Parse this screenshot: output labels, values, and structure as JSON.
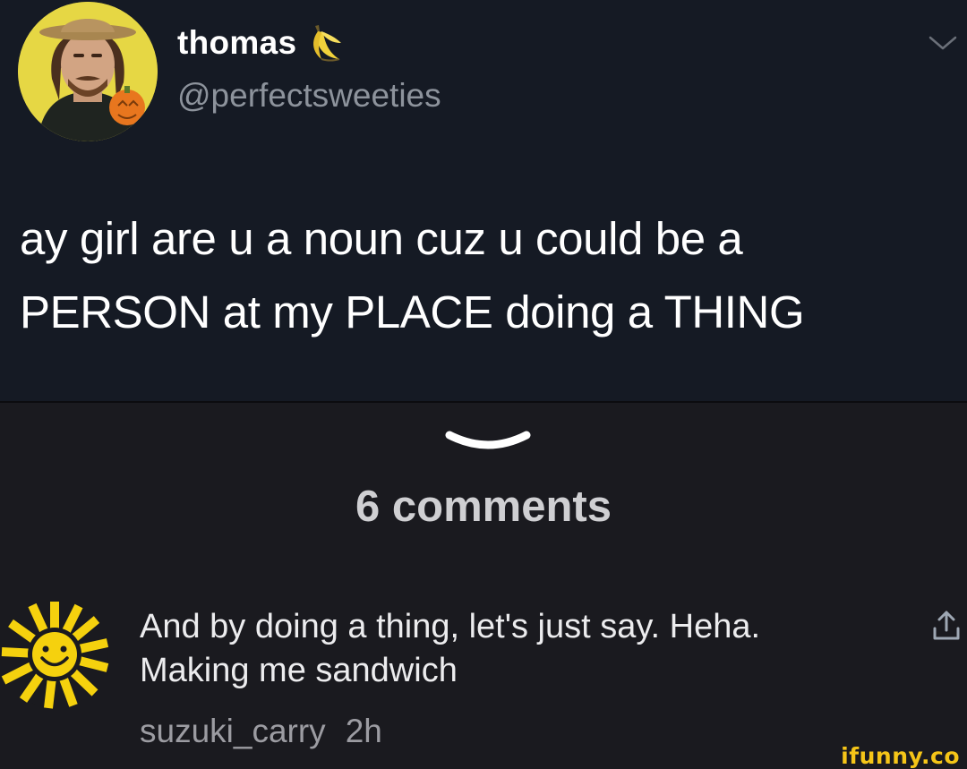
{
  "tweet": {
    "display_name": "thomas",
    "name_emoji": "banana-icon",
    "handle": "@perfectsweeties",
    "text_line1": "ay girl are u a noun cuz u could be a",
    "text_line2": "PERSON at my PLACE doing a THING"
  },
  "comments_header": {
    "count_label": "6 comments"
  },
  "comment": {
    "text_line1": "And by doing a thing, let's just say. Heha.",
    "text_line2": "Making me sandwich",
    "username": "suzuki_carry",
    "time": "2h",
    "avatar": "sun-face-icon"
  },
  "watermark": "ifunny.co",
  "colors": {
    "tweet_bg": "#151a24",
    "page_bg": "#1a1a1f",
    "accent_watermark": "#f5c518",
    "avatar_ring": "#e9d84a"
  }
}
